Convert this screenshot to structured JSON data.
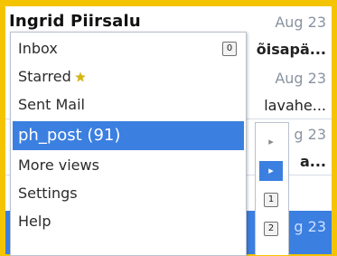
{
  "mail_list": [
    {
      "sender": "Ingrid Piirsalu",
      "date": "Aug 23",
      "subject": ""
    },
    {
      "sender": "",
      "date": "",
      "subject": "õisapä..."
    },
    {
      "sender": "",
      "date": "Aug 23",
      "subject": "lavahe..."
    },
    {
      "sender": "",
      "date": "g 23",
      "subject": "a..."
    },
    {
      "sender": "",
      "date": "g 23",
      "subject": ""
    }
  ],
  "menu": {
    "items": [
      {
        "label": "Inbox",
        "badge": "0"
      },
      {
        "label": "Starred",
        "icon": "star-icon"
      },
      {
        "label": "Sent Mail"
      },
      {
        "label": "ph_post (91)",
        "selected": true
      },
      {
        "label": "More views"
      },
      {
        "label": "Settings"
      },
      {
        "label": "Help"
      }
    ]
  },
  "side_column": {
    "cells": [
      {
        "glyph": "▸"
      },
      {
        "glyph": "▸",
        "selected": true
      },
      {
        "key": "1"
      },
      {
        "key": "2"
      }
    ]
  },
  "colors": {
    "border_frame": "#f5c400",
    "selection": "#3b7fe0",
    "date_text": "#8a93a0"
  }
}
